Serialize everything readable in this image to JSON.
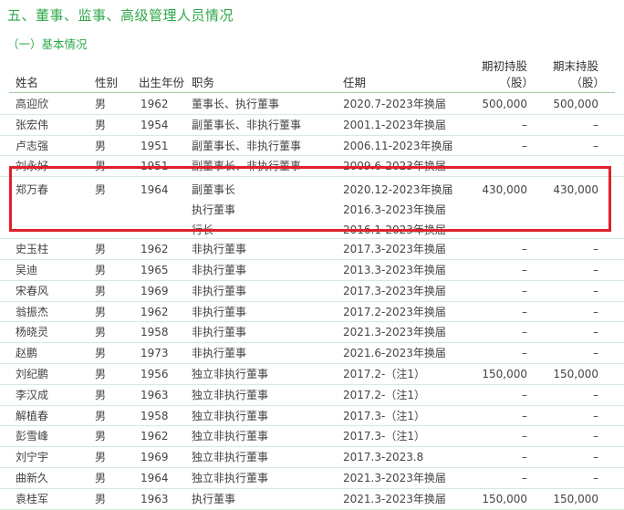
{
  "section_title": "五、董事、监事、高级管理人员情况",
  "subsection_title": "（一）基本情况",
  "headers": {
    "name": "姓名",
    "gender": "性别",
    "birth_year": "出生年份",
    "position": "职务",
    "term": "任期",
    "shares_start_line1": "期初持股",
    "shares_start_line2": "（股）",
    "shares_end_line1": "期末持股",
    "shares_end_line2": "（股）"
  },
  "rows_before": [
    {
      "name": "高迎欣",
      "gender": "男",
      "year": "1962",
      "position": "董事长、执行董事",
      "term": "2020.7-2023年换届",
      "start": "500,000",
      "end": "500,000"
    },
    {
      "name": "张宏伟",
      "gender": "男",
      "year": "1954",
      "position": "副董事长、非执行董事",
      "term": "2001.1-2023年换届",
      "start": "–",
      "end": "–"
    },
    {
      "name": "卢志强",
      "gender": "男",
      "year": "1951",
      "position": "副董事长、非执行董事",
      "term": "2006.11-2023年换届",
      "start": "–",
      "end": "–"
    },
    {
      "name": "刘永好",
      "gender": "男",
      "year": "1951",
      "position": "副董事长、非执行董事",
      "term": "2009.6-2023年换届",
      "start": "–",
      "end": "–"
    }
  ],
  "highlighted": {
    "name": "郑万春",
    "gender": "男",
    "year": "1964",
    "positions": [
      "副董事长",
      "执行董事",
      "行长"
    ],
    "terms": [
      "2020.12-2023年换届",
      "2016.3-2023年换届",
      "2016.1-2023年换届"
    ],
    "start": "430,000",
    "end": "430,000"
  },
  "rows_after": [
    {
      "name": "史玉柱",
      "gender": "男",
      "year": "1962",
      "position": "非执行董事",
      "term": "2017.3-2023年换届",
      "start": "–",
      "end": "–"
    },
    {
      "name": "吴迪",
      "gender": "男",
      "year": "1965",
      "position": "非执行董事",
      "term": "2013.3-2023年换届",
      "start": "–",
      "end": "–"
    },
    {
      "name": "宋春风",
      "gender": "男",
      "year": "1969",
      "position": "非执行董事",
      "term": "2017.3-2023年换届",
      "start": "–",
      "end": "–"
    },
    {
      "name": "翁振杰",
      "gender": "男",
      "year": "1962",
      "position": "非执行董事",
      "term": "2017.2-2023年换届",
      "start": "–",
      "end": "–"
    },
    {
      "name": "杨晓灵",
      "gender": "男",
      "year": "1958",
      "position": "非执行董事",
      "term": "2021.3-2023年换届",
      "start": "–",
      "end": "–"
    },
    {
      "name": "赵鹏",
      "gender": "男",
      "year": "1973",
      "position": "非执行董事",
      "term": "2021.6-2023年换届",
      "start": "–",
      "end": "–"
    },
    {
      "name": "刘纪鹏",
      "gender": "男",
      "year": "1956",
      "position": "独立非执行董事",
      "term": "2017.2-（注1）",
      "start": "150,000",
      "end": "150,000"
    },
    {
      "name": "李汉成",
      "gender": "男",
      "year": "1963",
      "position": "独立非执行董事",
      "term": "2017.2-（注1）",
      "start": "–",
      "end": "–"
    },
    {
      "name": "解植春",
      "gender": "男",
      "year": "1958",
      "position": "独立非执行董事",
      "term": "2017.3-（注1）",
      "start": "–",
      "end": "–"
    },
    {
      "name": "彭雪峰",
      "gender": "男",
      "year": "1962",
      "position": "独立非执行董事",
      "term": "2017.3-（注1）",
      "start": "–",
      "end": "–"
    },
    {
      "name": "刘宁宇",
      "gender": "男",
      "year": "1969",
      "position": "独立非执行董事",
      "term": "2017.3-2023.8",
      "start": "–",
      "end": "–"
    },
    {
      "name": "曲新久",
      "gender": "男",
      "year": "1964",
      "position": "独立非执行董事",
      "term": "2021.3-2023年换届",
      "start": "–",
      "end": "–"
    },
    {
      "name": "袁桂军",
      "gender": "男",
      "year": "1963",
      "position": "执行董事",
      "term": "2021.3-2023年换届",
      "start": "150,000",
      "end": "150,000"
    }
  ],
  "colors": {
    "accent": "#2ea84a",
    "highlight_border": "#e0202b",
    "rule": "#9ecba9"
  }
}
